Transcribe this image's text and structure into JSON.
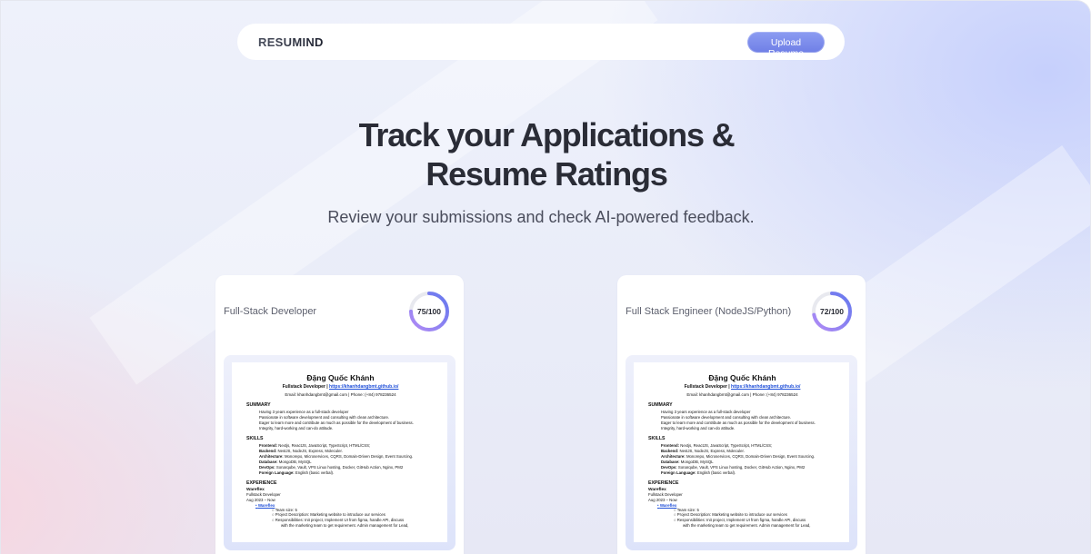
{
  "nav": {
    "logo": "RESUMIND",
    "upload_label": "Upload Resume"
  },
  "hero": {
    "title_line1": "Track your Applications &",
    "title_line2": "Resume Ratings",
    "subtitle": "Review your submissions and check AI-powered feedback."
  },
  "colors": {
    "accent": "#7b8aed",
    "score_ring_start": "#a78bfa",
    "score_ring_end": "#6d7ff0"
  },
  "cards": [
    {
      "job_title": "Full-Stack Developer",
      "score_text": "75/100",
      "score": 75
    },
    {
      "job_title": "Full Stack Engineer (NodeJS/Python)",
      "score_text": "72/100",
      "score": 72
    }
  ],
  "resume": {
    "name": "Đặng Quốc Khánh",
    "role": "Fullstack Developer",
    "role_sep": " | ",
    "site": "https://khanhdangbmt.github.io/",
    "contact": "Email: khanhdangbmt@gmail.com | Phone: (+84) 978236524",
    "summary_heading": "SUMMARY",
    "summary": [
      "Having 3 years experience as a full-stack developer",
      "Passionate in software development and consulting with clean architecture.",
      "Eager to learn more and contribute as much as possible for the development of business.",
      "Integrity,  hard-working and can-do attitude."
    ],
    "skills_heading": "SKILLS",
    "skills": [
      {
        "label": "Frontend:",
        "value": " Nextjs, ReactJS, JavaScript, TypeScript, HTML/CSS;"
      },
      {
        "label": "Backend:",
        "value": " NestJS, NodeJS, Express, Moleculer."
      },
      {
        "label": "Architecture:",
        "value": " Monorepo, Microservices, CQRS, Domain-Driven Design, Event Sourcing."
      },
      {
        "label": "Database:",
        "value": " MongoDB, MySQL"
      },
      {
        "label": "DevOps:",
        "value": " Sonarqube, Vault, VPS Linux hosting, Docker, GitHub Action, Nginx, PM2"
      },
      {
        "label": "Foreign Language:",
        "value": " English (basic verbal)."
      }
    ],
    "experience_heading": "EXPERIENCE",
    "company": "Wareflex",
    "position": "Fullstack Developer",
    "period": "Aug 2023 – Now",
    "project": "Wareflex",
    "project_details": [
      "Team size: 5",
      "Project Description: Marketing website to introduce our services",
      "Responsibilities: Init project, Implement UI from figma, handle API, discuss",
      "with the marketing team to get requirement. Admin management for Lead,"
    ]
  }
}
